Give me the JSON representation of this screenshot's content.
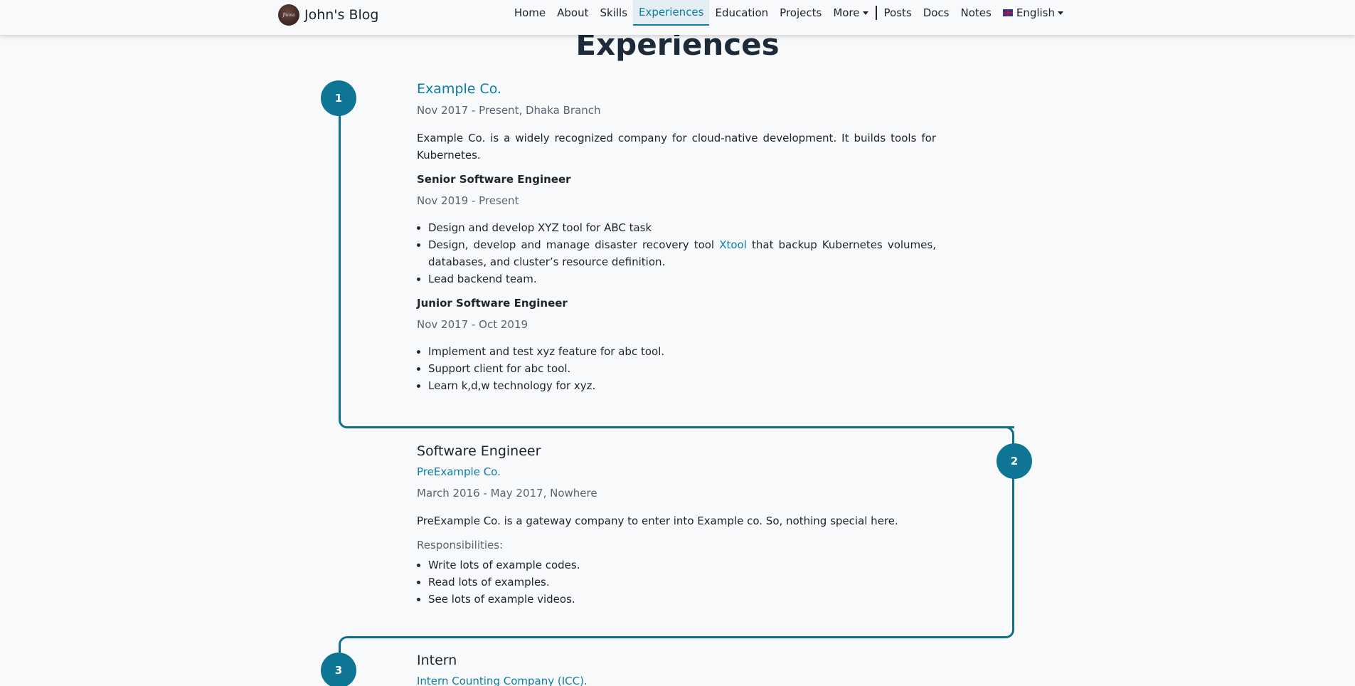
{
  "brand": {
    "name": "John's Blog",
    "logo_text": "Jhona"
  },
  "nav": {
    "items": [
      "Home",
      "About",
      "Skills",
      "Experiences",
      "Education",
      "Projects"
    ],
    "more": "More",
    "items2": [
      "Posts",
      "Docs",
      "Notes"
    ],
    "language": "English",
    "active": "Experiences"
  },
  "page": {
    "title": "Experiences"
  },
  "experiences": [
    {
      "number": "1",
      "company": "Example Co.",
      "period": "Nov 2017 - Present, Dhaka Branch",
      "description": "Example Co. is a widely recognized company for cloud-native development. It builds tools for Kubernetes.",
      "positions": [
        {
          "title": "Senior Software Engineer",
          "period": "Nov 2019 - Present",
          "bullets": [
            "Design and develop XYZ tool for ABC task",
            "Design, develop and manage disaster recovery tool",
            "Lead backend team."
          ],
          "link_text": "Xtool",
          "bullet2_suffix": "that backup Kubernetes volumes, databases, and cluster’s resource definition."
        },
        {
          "title": "Junior Software Engineer",
          "period": "Nov 2017 - Oct 2019",
          "bullets": [
            "Implement and test xyz feature for abc tool.",
            "Support client for abc tool.",
            "Learn k,d,w technology for xyz."
          ]
        }
      ]
    },
    {
      "number": "2",
      "role": "Software Engineer",
      "company": "PreExample Co.",
      "period": "March 2016 - May 2017, Nowhere",
      "description": "PreExample Co. is a gateway company to enter into Example co. So, nothing special here.",
      "responsibilities_label": "Responsibilities:",
      "bullets": [
        "Write lots of example codes.",
        "Read lots of examples.",
        "See lots of example videos."
      ]
    },
    {
      "number": "3",
      "role": "Intern",
      "company": "Intern Counting Company (ICC)."
    }
  ],
  "colors": {
    "accent": "#0a7ea4",
    "timeline": "#0e6f8a",
    "background": "#f8f9fa"
  }
}
